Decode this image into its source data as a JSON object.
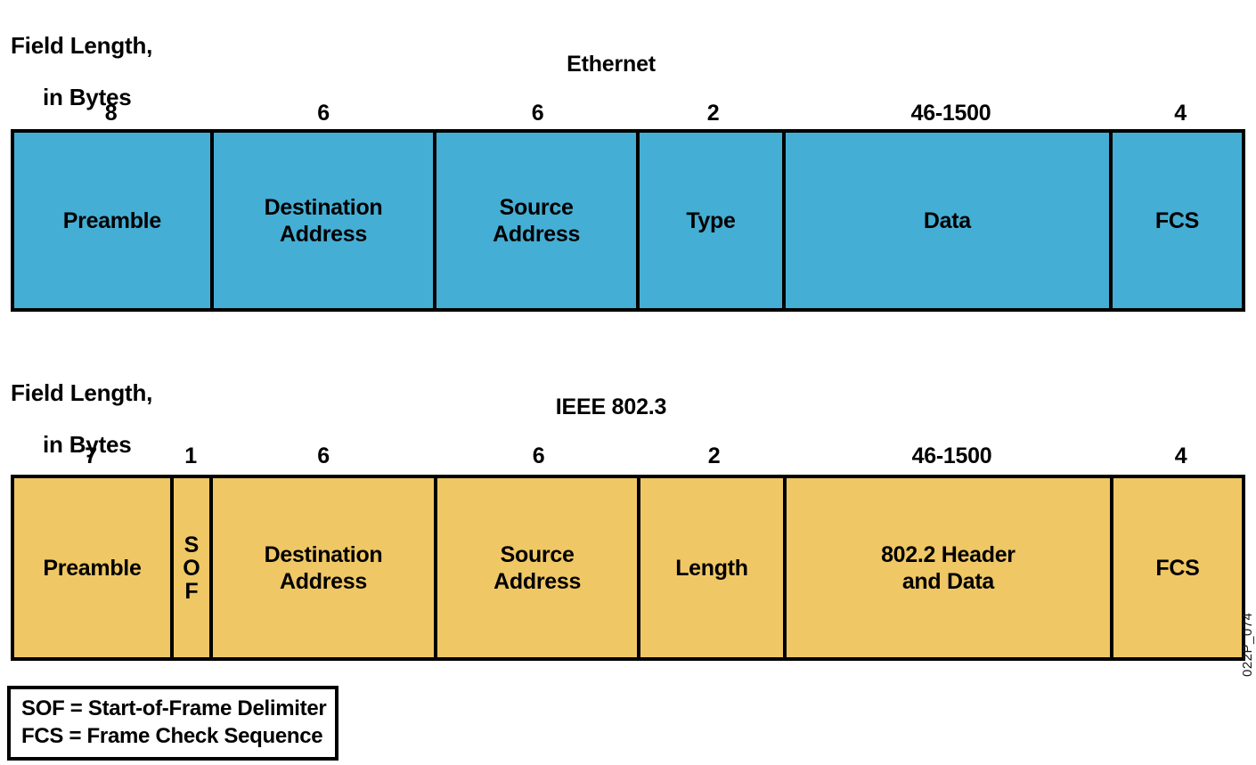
{
  "diagram": {
    "watermark": "022P_074",
    "colors": {
      "ethernet_fill": "#45aed4",
      "ieee_fill": "#efc765",
      "border": "#000000",
      "background": "#ffffff"
    }
  },
  "ethernet": {
    "caption_line1": "Field Length,",
    "caption_line2": "in Bytes",
    "title": "Ethernet",
    "lengths": [
      "8",
      "6",
      "6",
      "2",
      "46-1500",
      "4"
    ],
    "fields": [
      {
        "label": "Preamble"
      },
      {
        "label_line1": "Destination",
        "label_line2": "Address"
      },
      {
        "label_line1": "Source",
        "label_line2": "Address"
      },
      {
        "label": "Type"
      },
      {
        "label": "Data"
      },
      {
        "label": "FCS"
      }
    ]
  },
  "ieee": {
    "caption_line1": "Field Length,",
    "caption_line2": "in Bytes",
    "title": "IEEE 802.3",
    "lengths": [
      "7",
      "1",
      "6",
      "6",
      "2",
      "46-1500",
      "4"
    ],
    "fields": [
      {
        "label": "Preamble"
      },
      {
        "stacked_1": "S",
        "stacked_2": "O",
        "stacked_3": "F"
      },
      {
        "label_line1": "Destination",
        "label_line2": "Address"
      },
      {
        "label_line1": "Source",
        "label_line2": "Address"
      },
      {
        "label": "Length"
      },
      {
        "label_line1": "802.2 Header",
        "label_line2": "and Data"
      },
      {
        "label": "FCS"
      }
    ]
  },
  "legend": {
    "line1": "SOF = Start-of-Frame Delimiter",
    "line2": "FCS = Frame Check Sequence"
  }
}
